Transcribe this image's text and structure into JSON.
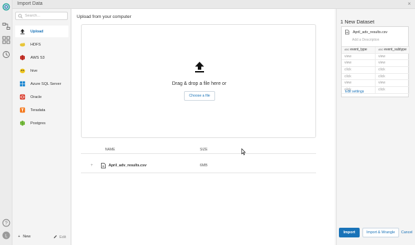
{
  "window": {
    "title": "Import Data",
    "close_glyph": "×"
  },
  "rail": {
    "icons": [
      "logo-icon",
      "flows-icon",
      "library-icon",
      "jobs-icon",
      "help-icon",
      "user-avatar-icon"
    ],
    "avatar_letter": "L",
    "help_glyph": "?"
  },
  "sources": {
    "search_placeholder": "Search...",
    "items": [
      {
        "label": "Upload",
        "icon": "upload-icon"
      },
      {
        "label": "HDFS",
        "icon": "hdfs-icon"
      },
      {
        "label": "AWS S3",
        "icon": "aws-s3-icon"
      },
      {
        "label": "hive",
        "icon": "hive-icon"
      },
      {
        "label": "Azure SQL Server",
        "icon": "azure-icon"
      },
      {
        "label": "Oracle",
        "icon": "oracle-icon"
      },
      {
        "label": "Teradata",
        "icon": "teradata-icon"
      },
      {
        "label": "Postgres",
        "icon": "postgres-icon"
      }
    ],
    "new_label": "New",
    "new_glyph": "+",
    "edit_label": "Edit"
  },
  "main": {
    "upload_title": "Upload from your computer",
    "drop_text": "Drag & drop a file here or",
    "choose_label": "Choose a file",
    "table": {
      "col_name": "NAME",
      "col_size": "SIZE",
      "rows": [
        {
          "expand": "+",
          "name": "April_adv_results.csv",
          "size": "6MB"
        }
      ]
    }
  },
  "dataset": {
    "title": "1 New Dataset",
    "file_name": "April_adv_results.csv",
    "description_placeholder": "Add a Description",
    "type_tag": "ABC",
    "columns": [
      "event_type",
      "event_subtype"
    ],
    "rows": [
      [
        "view",
        "view"
      ],
      [
        "view",
        "view"
      ],
      [
        "click",
        "click"
      ],
      [
        "click",
        "click"
      ],
      [
        "view",
        "view"
      ],
      [
        "click",
        "click"
      ]
    ],
    "edit_settings": "Edit settings",
    "import_label": "Import",
    "wrangle_label": "Import & Wrangle",
    "cancel_label": "Cancel"
  },
  "colors": {
    "accent": "#1a73b8",
    "panel_bg": "#f4f4f4"
  }
}
